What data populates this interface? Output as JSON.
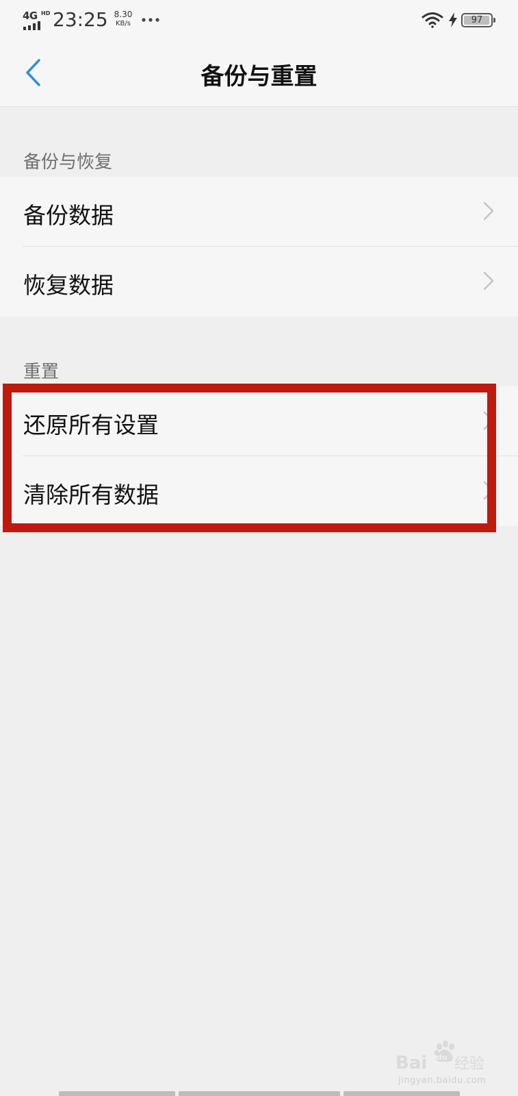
{
  "status_bar": {
    "network": "4G",
    "network_badge": "HD",
    "time": "23:25",
    "speed_value": "8.30",
    "speed_unit": "KB/s",
    "battery": "97",
    "battery_level": 0.97
  },
  "header": {
    "title": "备份与重置"
  },
  "sections": [
    {
      "title": "备份与恢复",
      "items": [
        {
          "label": "备份数据"
        },
        {
          "label": "恢复数据"
        }
      ]
    },
    {
      "title": "重置",
      "items": [
        {
          "label": "还原所有设置"
        },
        {
          "label": "清除所有数据"
        }
      ]
    }
  ],
  "watermark": {
    "logo_text": "Baidu经验",
    "url": "jingyan.baidu.com"
  },
  "colors": {
    "accent": "#2f8fe0",
    "highlight_border": "#bd1b10",
    "background": "#efefef",
    "row_background": "#f6f6f6"
  }
}
